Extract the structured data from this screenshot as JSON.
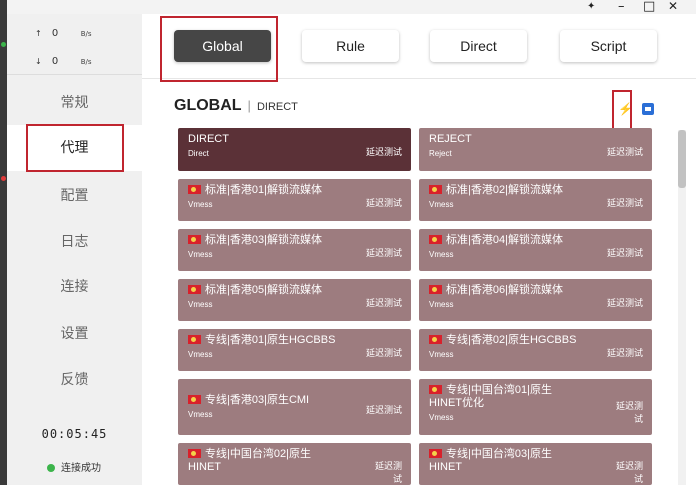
{
  "window": {
    "pin_icon": "pin-icon",
    "minimize_glyph": "–",
    "maximize_glyph": "□",
    "close_glyph": "✕"
  },
  "traffic": {
    "up": {
      "arrow": "↑",
      "value": "0",
      "unit": "B/s"
    },
    "down": {
      "arrow": "↓",
      "value": "0",
      "unit": "B/s"
    }
  },
  "nav": [
    {
      "label": "常规"
    },
    {
      "label": "代理"
    },
    {
      "label": "配置"
    },
    {
      "label": "日志"
    },
    {
      "label": "连接"
    },
    {
      "label": "设置"
    },
    {
      "label": "反馈"
    }
  ],
  "active_nav": "代理",
  "timer": "00:05:45",
  "status": "连接成功",
  "modes": [
    {
      "label": "Global"
    },
    {
      "label": "Rule"
    },
    {
      "label": "Direct"
    },
    {
      "label": "Script"
    }
  ],
  "active_mode": "Global",
  "group": {
    "name": "GLOBAL",
    "selected": "DIRECT"
  },
  "colors": {
    "card": "#9d7c7f",
    "card_selected": "#5b3137",
    "highlight": "#c0252f",
    "accent": "#2b6fd6"
  },
  "proxies": [
    {
      "name": "DIRECT",
      "type": "Direct",
      "latency": "延迟测试",
      "flag": false,
      "selected": true
    },
    {
      "name": "REJECT",
      "type": "Reject",
      "latency": "延迟测试",
      "flag": false,
      "selected": false
    },
    {
      "name": "标准|香港01|解锁流媒体",
      "type": "Vmess",
      "latency": "延迟测试",
      "flag": true
    },
    {
      "name": "标准|香港02|解锁流媒体",
      "type": "Vmess",
      "latency": "延迟测试",
      "flag": true
    },
    {
      "name": "标准|香港03|解锁流媒体",
      "type": "Vmess",
      "latency": "延迟测试",
      "flag": true
    },
    {
      "name": "标准|香港04|解锁流媒体",
      "type": "Vmess",
      "latency": "延迟测试",
      "flag": true
    },
    {
      "name": "标准|香港05|解锁流媒体",
      "type": "Vmess",
      "latency": "延迟测试",
      "flag": true
    },
    {
      "name": "标准|香港06|解锁流媒体",
      "type": "Vmess",
      "latency": "延迟测试",
      "flag": true
    },
    {
      "name": "专线|香港01|原生HGCBBS",
      "type": "Vmess",
      "latency": "延迟测试",
      "flag": true
    },
    {
      "name": "专线|香港02|原生HGCBBS",
      "type": "Vmess",
      "latency": "延迟测试",
      "flag": true
    },
    {
      "name": "专线|香港03|原生CMI",
      "type": "Vmess",
      "latency": "延迟测试",
      "flag": true
    },
    {
      "name": "专线|中国台湾01|原生HINET优化",
      "type": "Vmess",
      "latency": "延迟测试",
      "flag": true
    },
    {
      "name": "专线|中国台湾02|原生HINET",
      "type": "",
      "latency": "延迟测试",
      "flag": true
    },
    {
      "name": "专线|中国台湾03|原生HINET",
      "type": "",
      "latency": "延迟测试",
      "flag": true
    }
  ]
}
